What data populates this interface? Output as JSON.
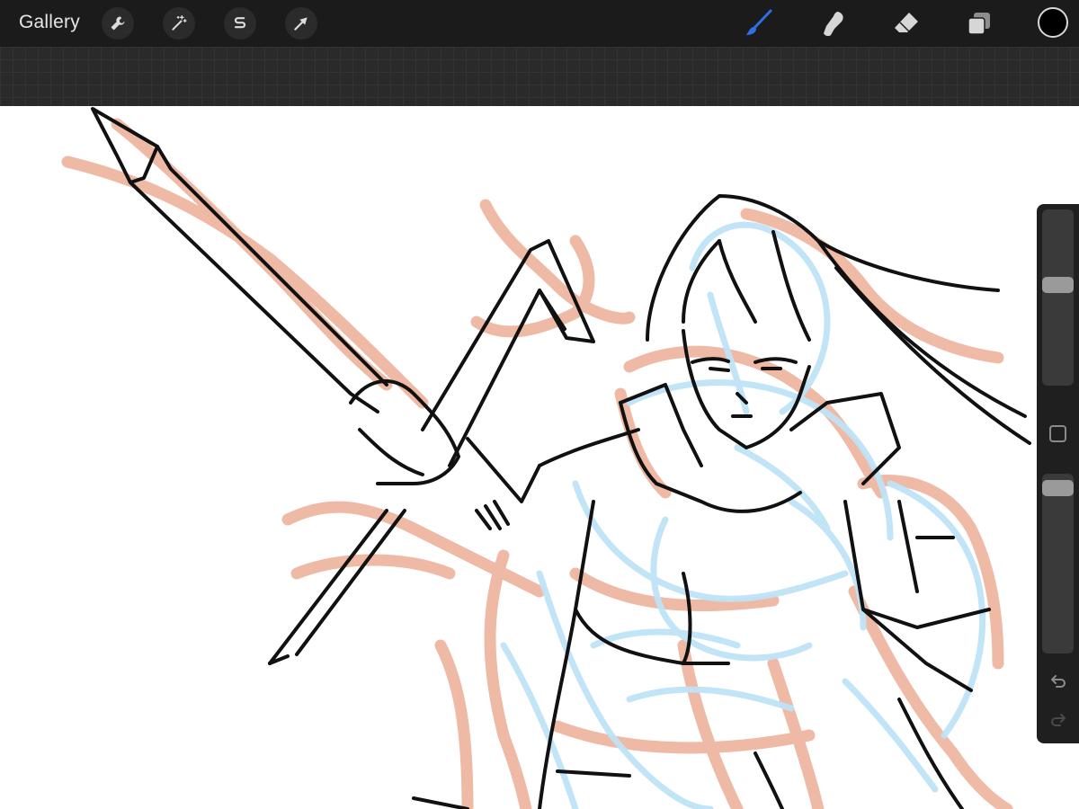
{
  "toolbar": {
    "gallery_label": "Gallery",
    "left_tools": [
      {
        "name": "actions",
        "icon": "wrench-icon"
      },
      {
        "name": "adjustments",
        "icon": "magic-wand-icon"
      },
      {
        "name": "selection",
        "icon": "selection-s-icon"
      },
      {
        "name": "transform",
        "icon": "arrow-cursor-icon"
      }
    ],
    "right_tools": [
      {
        "name": "brush",
        "icon": "brush-icon",
        "active": true
      },
      {
        "name": "smudge",
        "icon": "smudge-finger-icon",
        "active": false
      },
      {
        "name": "eraser",
        "icon": "eraser-icon",
        "active": false
      },
      {
        "name": "layers",
        "icon": "layers-icon",
        "active": false
      }
    ],
    "current_color": "#000000",
    "accent_color": "#2f6fe6"
  },
  "sidebar": {
    "brush_size_level": 0.6,
    "opacity_level": 0.97,
    "modify_icon": "square-icon",
    "undo_icon": "undo-icon",
    "redo_icon": "redo-icon"
  },
  "canvas": {
    "sketch_colors": {
      "rough": "#eeb7a2",
      "construction": "#bfe3f7",
      "ink": "#111111"
    }
  }
}
